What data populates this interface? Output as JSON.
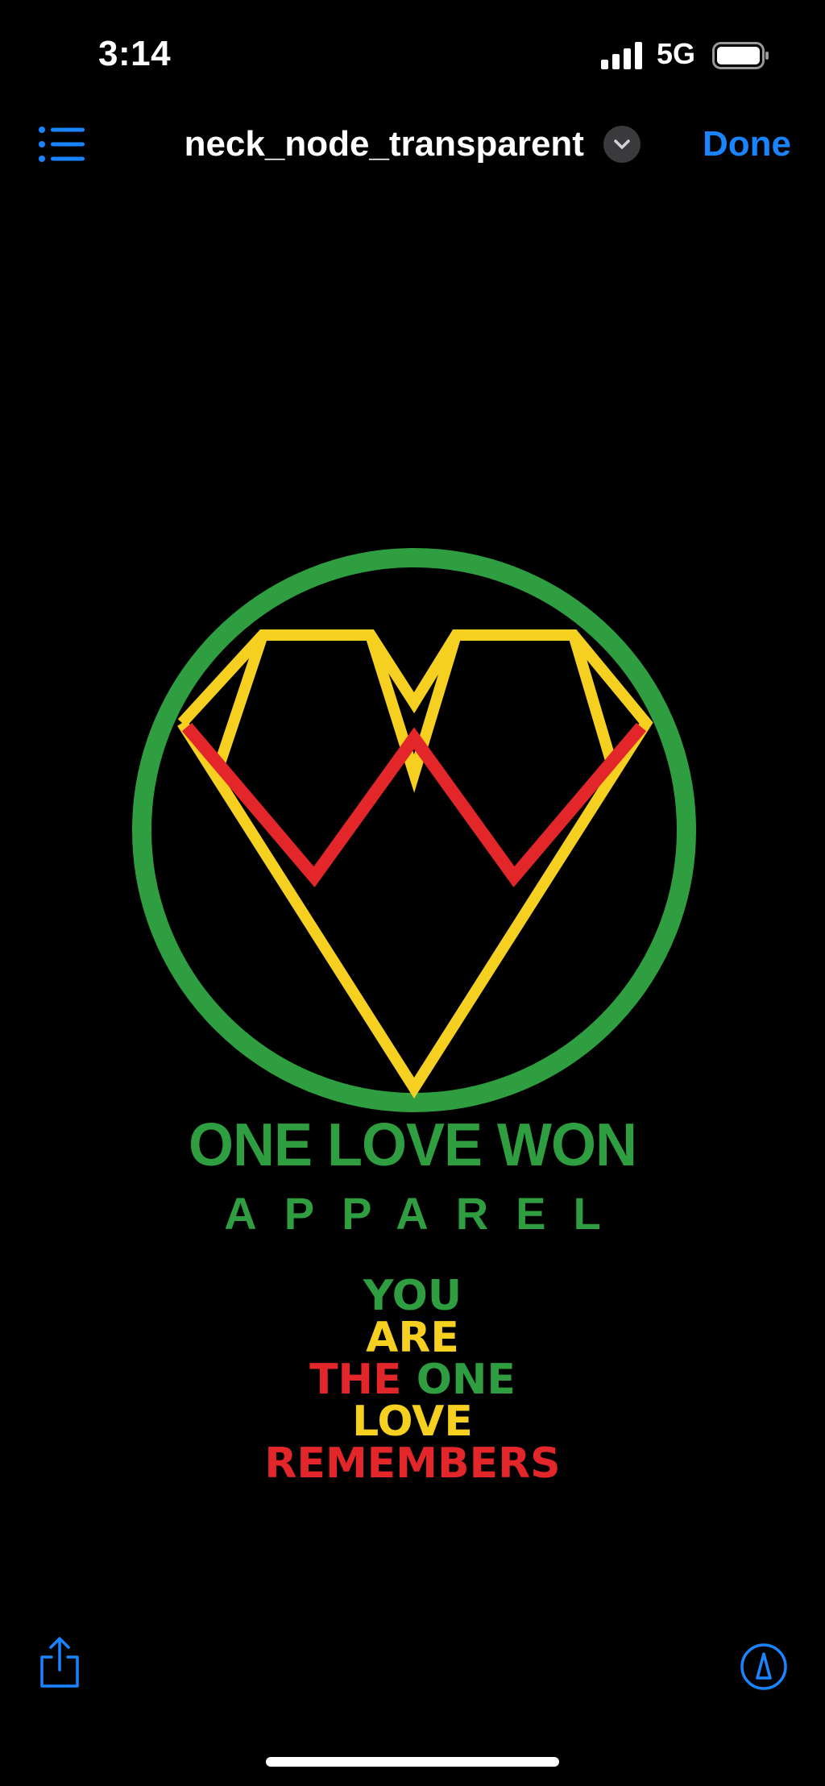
{
  "status_bar": {
    "time": "3:14",
    "network": "5G"
  },
  "nav": {
    "title": "neck_node_transparent",
    "done_label": "Done",
    "list_icon": "list-icon",
    "chevron_icon": "chevron-down-icon"
  },
  "artwork": {
    "brand_name": "ONE LOVE WON",
    "brand_sub": "APPAREL",
    "slogan": {
      "line1": "YOU",
      "line2": "ARE",
      "line3_a": "THE",
      "line3_b": "ONE",
      "line4": "LOVE",
      "line5": "REMEMBERS"
    },
    "colors": {
      "green": "#2f9e41",
      "yellow": "#f5d020",
      "red": "#e3262a"
    }
  },
  "toolbar": {
    "share_icon": "share-icon",
    "markup_icon": "markup-icon"
  },
  "colors": {
    "accent": "#1a84ff",
    "background": "#000000"
  }
}
